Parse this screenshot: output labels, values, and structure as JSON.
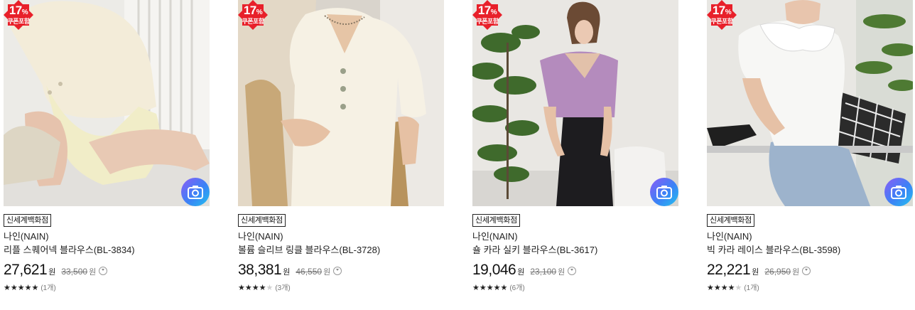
{
  "products": [
    {
      "discount": "17",
      "discount_unit": "%",
      "coupon": "쿠폰포함",
      "store": "신세계백화점",
      "brand": "나인(NAIN)",
      "name": "리플 스퀘어넥 블라우스(BL-3834)",
      "price": "27,621",
      "currency": "원",
      "original_price": "33,500",
      "original_currency": "원",
      "stars_on": "★★★★★",
      "stars_off": "",
      "rating": 5,
      "reviews": "(1개)"
    },
    {
      "discount": "17",
      "discount_unit": "%",
      "coupon": "쿠폰포함",
      "store": "신세계백화점",
      "brand": "나인(NAIN)",
      "name": "볼륨 슬리브 링클 블라우스(BL-3728)",
      "price": "38,381",
      "currency": "원",
      "original_price": "46,550",
      "original_currency": "원",
      "stars_on": "★★★★",
      "stars_off": "★",
      "rating": 4,
      "reviews": "(3개)"
    },
    {
      "discount": "17",
      "discount_unit": "%",
      "coupon": "쿠폰포함",
      "store": "신세계백화점",
      "brand": "나인(NAIN)",
      "name": "숄 카라 실키 블라우스(BL-3617)",
      "price": "19,046",
      "currency": "원",
      "original_price": "23,100",
      "original_currency": "원",
      "stars_on": "★★★★★",
      "stars_off": "",
      "rating": 5,
      "reviews": "(6개)"
    },
    {
      "discount": "17",
      "discount_unit": "%",
      "coupon": "쿠폰포함",
      "store": "신세계백화점",
      "brand": "나인(NAIN)",
      "name": "빅 카라 레이스 블라우스(BL-3598)",
      "price": "22,221",
      "currency": "원",
      "original_price": "26,950",
      "original_currency": "원",
      "stars_on": "★★★★",
      "stars_off": "★",
      "rating": 4,
      "reviews": "(1개)"
    }
  ],
  "colors": {
    "badge": "#e8202a",
    "camera_gradient": [
      "#8b5cf6",
      "#3b82f6",
      "#22c3ee"
    ]
  },
  "icons": {
    "camera": "camera-icon",
    "info": "info-circle-icon",
    "star": "star-icon"
  }
}
